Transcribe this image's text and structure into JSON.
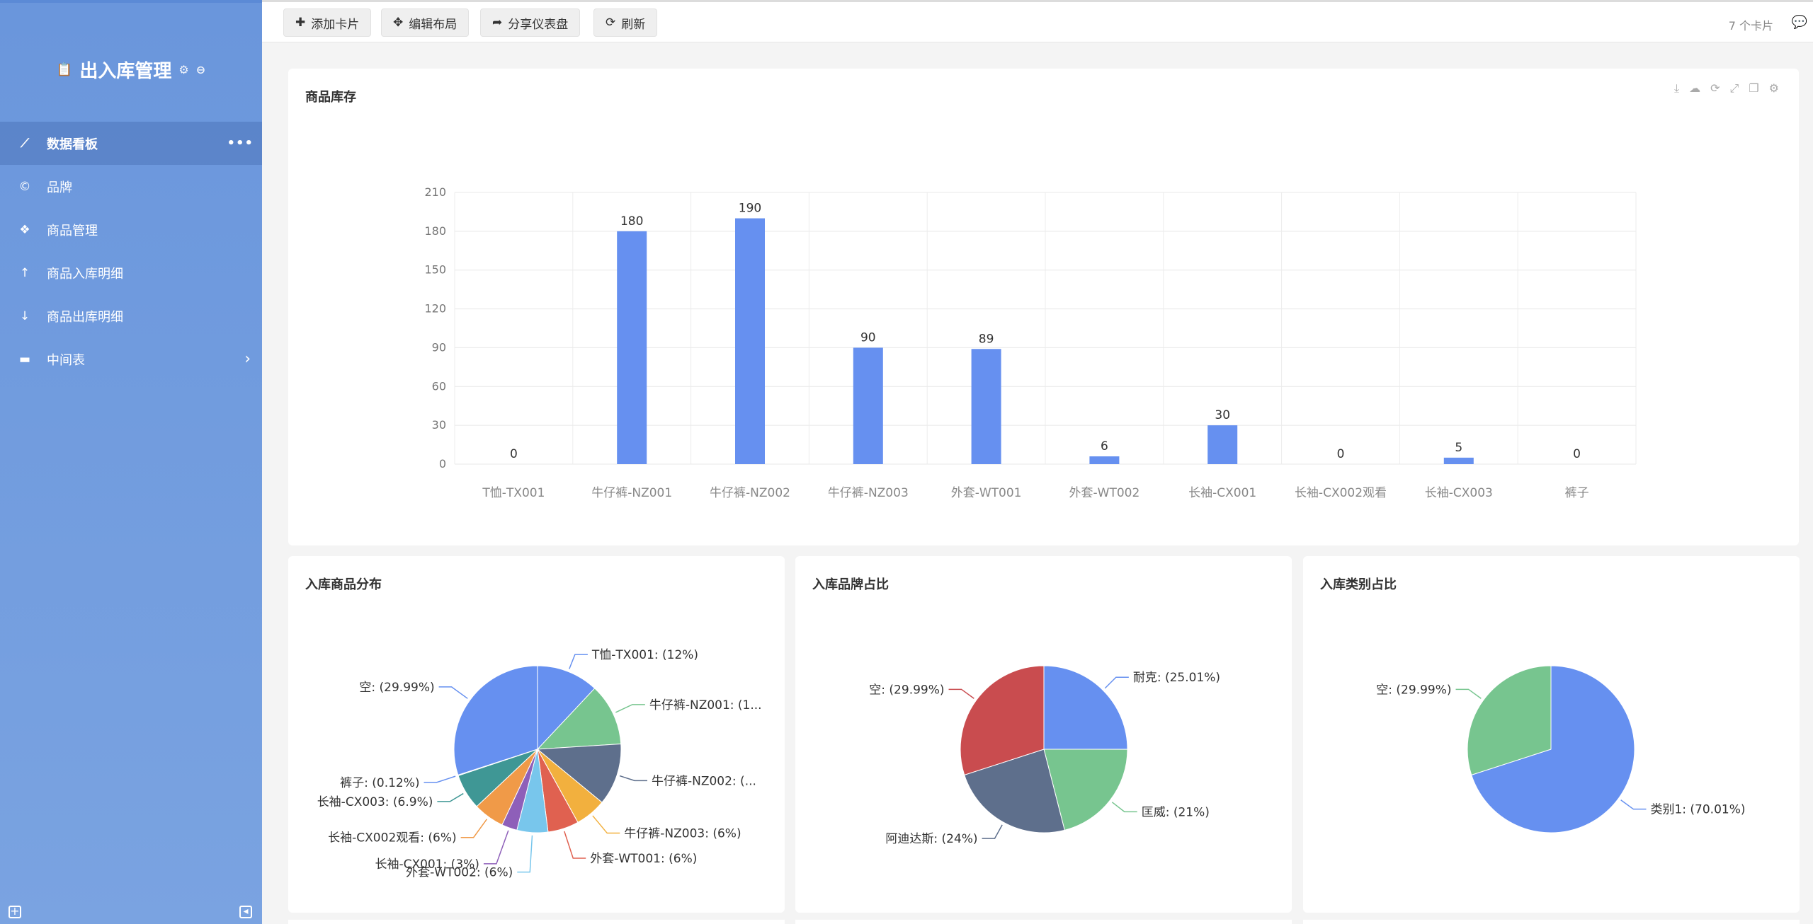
{
  "sidebar": {
    "app_title": "出入库管理",
    "items": [
      {
        "label": "数据看板",
        "icon": "line-chart-icon",
        "glyph": "⟋",
        "active": true
      },
      {
        "label": "品牌",
        "icon": "creative-commons-icon",
        "glyph": "©",
        "active": false
      },
      {
        "label": "商品管理",
        "icon": "cubes-icon",
        "glyph": "❖",
        "active": false
      },
      {
        "label": "商品入库明细",
        "icon": "arrow-up-icon",
        "glyph": "↑",
        "active": false
      },
      {
        "label": "商品出库明细",
        "icon": "arrow-down-icon",
        "glyph": "↓",
        "active": false
      },
      {
        "label": "中间表",
        "icon": "folder-icon",
        "glyph": "▬",
        "active": false
      }
    ]
  },
  "toolbar": {
    "add_card": "添加卡片",
    "edit_layout": "编辑布局",
    "share": "分享仪表盘",
    "refresh": "刷新",
    "card_count": "7 个卡片"
  },
  "cards": {
    "stock": {
      "title": "商品库存"
    },
    "inbound_goods": {
      "title": "入库商品分布"
    },
    "inbound_brand": {
      "title": "入库品牌占比"
    },
    "inbound_category": {
      "title": "入库类别占比"
    }
  },
  "colors": {
    "blue": "#6690f0",
    "green": "#77c58f",
    "slate": "#5e6f8c",
    "orange": "#f2b03e",
    "red": "#e06150",
    "lightblue": "#78c6ec",
    "purple": "#8e5fb9",
    "amber": "#f09a48",
    "teal": "#3f9795",
    "darkred": "#c94c4f"
  },
  "chart_data": [
    {
      "type": "bar",
      "title": "商品库存",
      "categories": [
        "T恤-TX001",
        "牛仔裤-NZ001",
        "牛仔裤-NZ002",
        "牛仔裤-NZ003",
        "外套-WT001",
        "外套-WT002",
        "长袖-CX001",
        "长袖-CX002观看",
        "长袖-CX003",
        "裤子"
      ],
      "values": [
        0,
        180,
        190,
        90,
        89,
        6,
        30,
        0,
        5,
        0
      ],
      "ylim": [
        0,
        210
      ],
      "yticks": [
        0,
        30,
        60,
        90,
        120,
        150,
        180,
        210
      ],
      "grid": true
    },
    {
      "type": "pie",
      "title": "入库商品分布",
      "slices": [
        {
          "label": "空: (29.99%)",
          "value": 29.99,
          "color": "#6690f0"
        },
        {
          "label": "T恤-TX001: (12%)",
          "value": 12,
          "color": "#6690f0"
        },
        {
          "label": "牛仔裤-NZ001: (1...",
          "value": 12,
          "color": "#77c58f"
        },
        {
          "label": "牛仔裤-NZ002: (...",
          "value": 12,
          "color": "#5e6f8c"
        },
        {
          "label": "牛仔裤-NZ003: (6%)",
          "value": 6,
          "color": "#f2b03e"
        },
        {
          "label": "外套-WT001: (6%)",
          "value": 6,
          "color": "#e06150"
        },
        {
          "label": "外套-WT002: (6%)",
          "value": 6,
          "color": "#78c6ec"
        },
        {
          "label": "长袖-CX001: (3%)",
          "value": 3,
          "color": "#8e5fb9"
        },
        {
          "label": "长袖-CX002观看: (6%)",
          "value": 6,
          "color": "#f09a48"
        },
        {
          "label": "长袖-CX003: (6.9%)",
          "value": 6.9,
          "color": "#3f9795"
        },
        {
          "label": "裤子: (0.12%)",
          "value": 0.12,
          "color": "#6690f0"
        }
      ]
    },
    {
      "type": "pie",
      "title": "入库品牌占比",
      "slices": [
        {
          "label": "耐克: (25.01%)",
          "value": 25.01,
          "color": "#6690f0"
        },
        {
          "label": "匡威: (21%)",
          "value": 21,
          "color": "#77c58f"
        },
        {
          "label": "阿迪达斯: (24%)",
          "value": 24,
          "color": "#5e6f8c"
        },
        {
          "label": "空: (29.99%)",
          "value": 29.99,
          "color": "#c94c4f"
        }
      ]
    },
    {
      "type": "pie",
      "title": "入库类别占比",
      "slices": [
        {
          "label": "类别1: (70.01%)",
          "value": 70.01,
          "color": "#6690f0"
        },
        {
          "label": "空: (29.99%)",
          "value": 29.99,
          "color": "#77c58f"
        }
      ]
    }
  ]
}
